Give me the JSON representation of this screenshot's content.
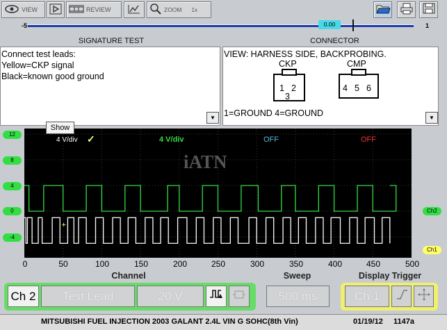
{
  "toolbar": {
    "view_label": "VIEW",
    "review_label": "REVIEW",
    "zoom_label": "ZOOM",
    "zoom_suffix": "1x"
  },
  "timeline": {
    "left_value": "-5",
    "marker_value": "0.00",
    "right_value": "1"
  },
  "signature_test": {
    "header": "SIGNATURE TEST",
    "lines": [
      "Connect test leads:",
      "Yellow=CKP signal",
      "Black=known good ground"
    ]
  },
  "connector": {
    "header": "CONNECTOR",
    "view_text": "VIEW: HARNESS SIDE, BACKPROBING.",
    "ckp_label": "CKP",
    "ckp_pins": [
      "1",
      "2",
      "3"
    ],
    "cmp_label": "CMP",
    "cmp_pins": [
      "4",
      "5",
      "6"
    ],
    "footer": "1=GROUND 4=GROUND"
  },
  "tooltip": "Show",
  "scope": {
    "ch1_scale": "4 V/div",
    "ch2_scale": "4 V/div",
    "ch3_state": "OFF",
    "ch4_state": "OFF",
    "watermark": "iATN",
    "left_tick_labels": [
      "12",
      "8",
      "4",
      "0",
      "-4"
    ],
    "right_labels": [
      "Ch2",
      "Ch1"
    ]
  },
  "chart_data": {
    "type": "line",
    "xlabel": "Channel",
    "x_ticks": [
      0,
      50,
      100,
      150,
      200,
      250,
      300,
      350,
      400,
      450,
      500
    ],
    "xlim": [
      0,
      500
    ],
    "series": [
      {
        "name": "Ch2",
        "color": "#33dd44",
        "low": 0,
        "high": 4,
        "edges": [
          0,
          6,
          25,
          50,
          80,
          100,
          130,
          150,
          185,
          200,
          230,
          250,
          280,
          302,
          332,
          350,
          380,
          400,
          430,
          450,
          480
        ]
      },
      {
        "name": "Ch1",
        "color": "#ffffff",
        "low": -5,
        "high": -1,
        "edges": [
          0,
          2,
          4,
          10,
          18,
          23,
          36,
          46,
          56,
          64,
          70,
          80,
          92,
          102,
          114,
          124,
          134,
          144,
          156,
          166,
          176,
          186,
          198,
          210,
          222,
          232,
          244,
          254,
          266,
          276,
          290,
          300,
          312,
          322,
          334,
          344,
          354,
          364,
          376,
          386,
          396,
          408,
          420,
          430,
          440,
          452,
          462,
          472
        ]
      }
    ]
  },
  "controls": {
    "channel_label": "Channel",
    "sweep_label": "Sweep",
    "trigger_label": "Display Trigger",
    "ch_button": "Ch 2",
    "test_lead_button": "Test Lead",
    "volts_button": "20 V",
    "sweep_button": "500 ms",
    "trigger_ch_button": "Ch 1"
  },
  "status": {
    "vehicle": "MITSUBISHI FUEL INJECTION 2003 GALANT 2.4L VIN G SOHC(8th Vin)",
    "date": "01/19/12",
    "time": "1147a"
  },
  "colors": {
    "ch1": "#ffffff",
    "ch2": "#33dd44",
    "ch1_label_bg": "#ffff66",
    "ch2_label_bg": "#33dd44",
    "timeline_bar": "#1a3aa8",
    "marker": "#48d8e8",
    "trigger_group": "#f0f070",
    "channel_group": "#66dd66"
  }
}
